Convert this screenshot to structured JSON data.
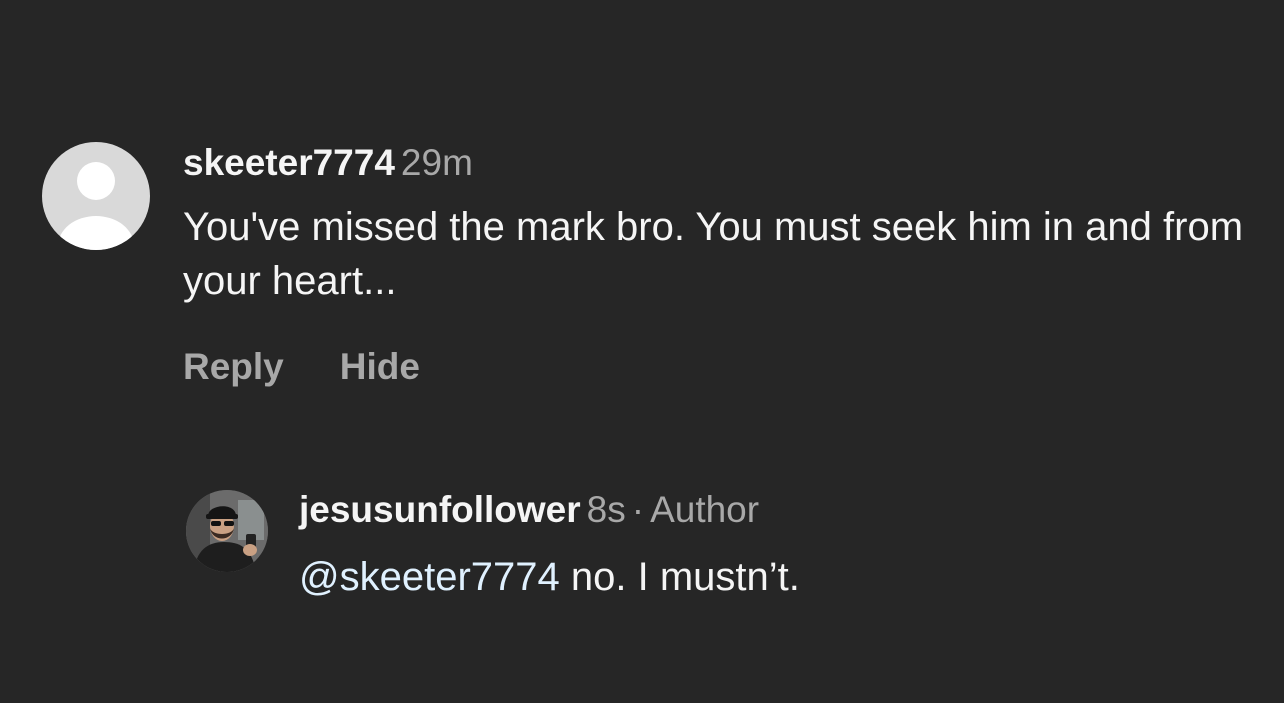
{
  "comment": {
    "username": "skeeter7774",
    "time": "29m",
    "text": "You've missed the mark bro. You must seek him in and from your heart...",
    "actions": {
      "reply": "Reply",
      "hide": "Hide"
    }
  },
  "reply": {
    "username": "jesusunfollower",
    "time": "8s",
    "separator": "·",
    "badge": "Author",
    "mention": "@skeeter7774",
    "text": " no. I mustn’t."
  },
  "colors": {
    "background": "#262626",
    "primary_text": "#f5f5f5",
    "secondary_text": "#a8a8a8",
    "mention": "#e0f1ff"
  },
  "icons": {
    "comment_avatar": "default-avatar-icon",
    "reply_avatar": "user-photo-avatar"
  }
}
